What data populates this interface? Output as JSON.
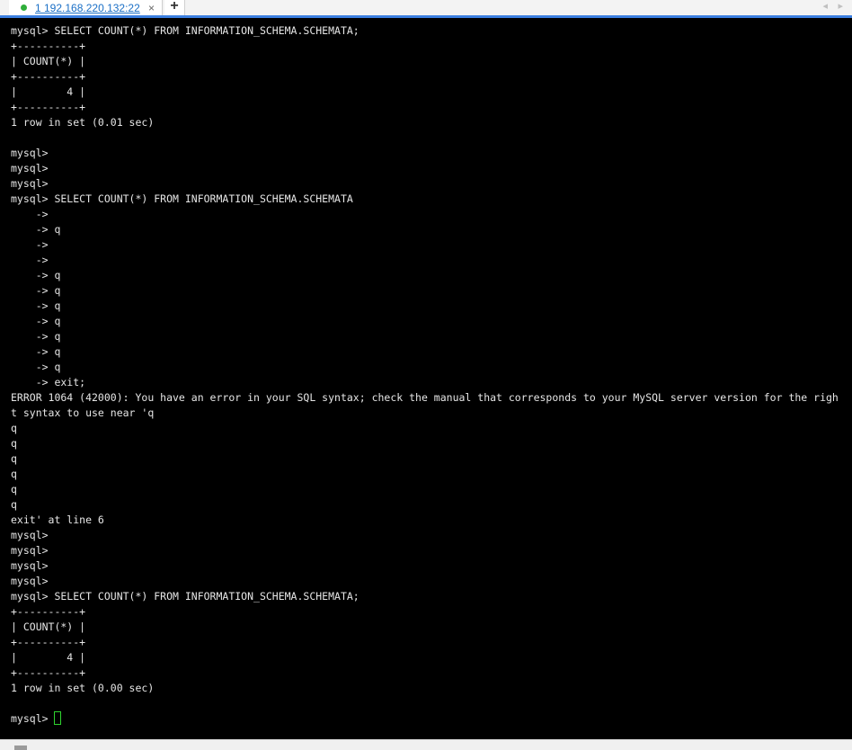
{
  "tab": {
    "label": "1 192.168.220.132:22",
    "close": "×"
  },
  "new_tab": "+",
  "scroll": {
    "left": "◂",
    "right": "▸"
  },
  "terminal": {
    "lines": [
      "mysql> SELECT COUNT(*) FROM INFORMATION_SCHEMA.SCHEMATA;",
      "+----------+",
      "| COUNT(*) |",
      "+----------+",
      "|        4 |",
      "+----------+",
      "1 row in set (0.01 sec)",
      "",
      "mysql>",
      "mysql>",
      "mysql>",
      "mysql> SELECT COUNT(*) FROM INFORMATION_SCHEMA.SCHEMATA",
      "    ->",
      "    -> q",
      "    ->",
      "    ->",
      "    -> q",
      "    -> q",
      "    -> q",
      "    -> q",
      "    -> q",
      "    -> q",
      "    -> q",
      "    -> exit;",
      "ERROR 1064 (42000): You have an error in your SQL syntax; check the manual that corresponds to your MySQL server version for the righ",
      "t syntax to use near 'q",
      "q",
      "q",
      "q",
      "q",
      "q",
      "q",
      "exit' at line 6",
      "mysql>",
      "mysql>",
      "mysql>",
      "mysql>",
      "mysql> SELECT COUNT(*) FROM INFORMATION_SCHEMA.SCHEMATA;",
      "+----------+",
      "| COUNT(*) |",
      "+----------+",
      "|        4 |",
      "+----------+",
      "1 row in set (0.00 sec)",
      ""
    ],
    "prompt": "mysql> "
  },
  "colors": {
    "background": "#000000",
    "text": "#e6e6e6",
    "accent": "#3c7fe0",
    "status": "#2fae3a",
    "cursor": "#2fd42f"
  }
}
